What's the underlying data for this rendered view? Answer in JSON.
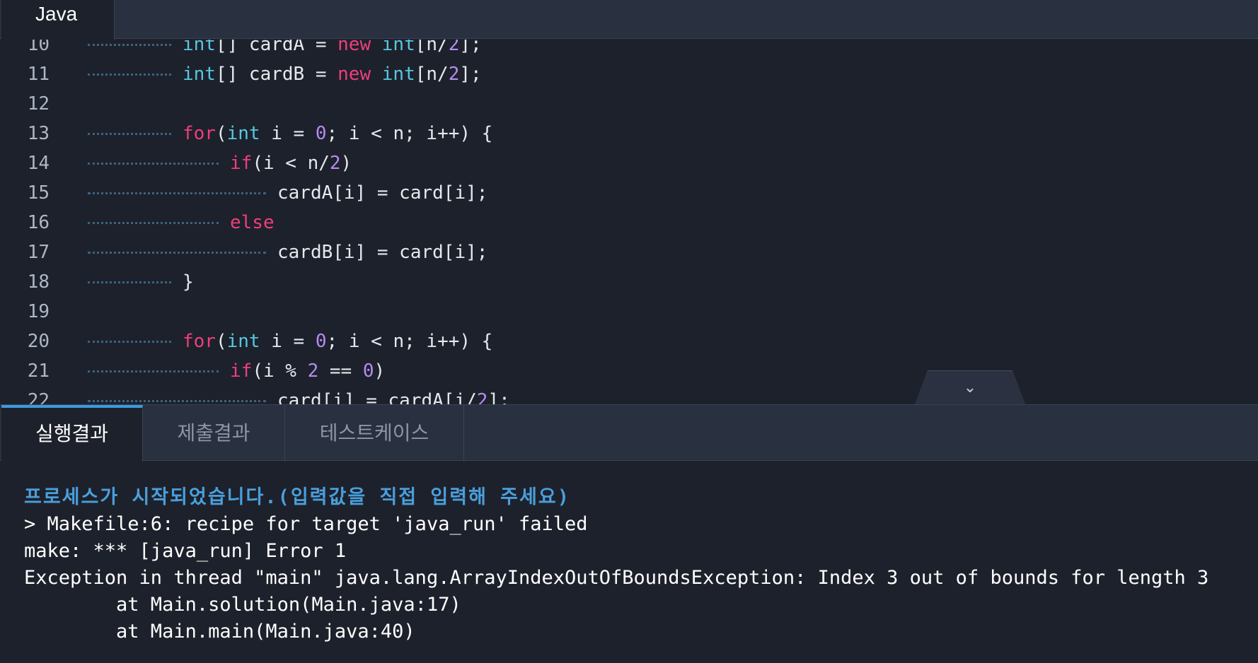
{
  "editor": {
    "language_tab": "Java",
    "lines": [
      {
        "num": "10",
        "indent": 2,
        "tokens": [
          [
            "ty",
            "int"
          ],
          [
            "p",
            "[] cardA = "
          ],
          [
            "kw",
            "new"
          ],
          [
            "p",
            " "
          ],
          [
            "ty",
            "int"
          ],
          [
            "p",
            "[n/"
          ],
          [
            "nm",
            "2"
          ],
          [
            "p",
            "];"
          ]
        ]
      },
      {
        "num": "11",
        "indent": 2,
        "tokens": [
          [
            "ty",
            "int"
          ],
          [
            "p",
            "[] cardB = "
          ],
          [
            "kw",
            "new"
          ],
          [
            "p",
            " "
          ],
          [
            "ty",
            "int"
          ],
          [
            "p",
            "[n/"
          ],
          [
            "nm",
            "2"
          ],
          [
            "p",
            "];"
          ]
        ]
      },
      {
        "num": "12",
        "indent": 0,
        "tokens": []
      },
      {
        "num": "13",
        "indent": 2,
        "tokens": [
          [
            "kw",
            "for"
          ],
          [
            "p",
            "("
          ],
          [
            "ty",
            "int"
          ],
          [
            "p",
            " i = "
          ],
          [
            "nm",
            "0"
          ],
          [
            "p",
            "; i < n; i++) {"
          ]
        ]
      },
      {
        "num": "14",
        "indent": 3,
        "tokens": [
          [
            "kw",
            "if"
          ],
          [
            "p",
            "(i < n/"
          ],
          [
            "nm",
            "2"
          ],
          [
            "p",
            ")"
          ]
        ]
      },
      {
        "num": "15",
        "indent": 4,
        "tokens": [
          [
            "p",
            "cardA[i] = card[i];"
          ]
        ]
      },
      {
        "num": "16",
        "indent": 3,
        "tokens": [
          [
            "kw",
            "else"
          ]
        ]
      },
      {
        "num": "17",
        "indent": 4,
        "tokens": [
          [
            "p",
            "cardB[i] = card[i];"
          ]
        ]
      },
      {
        "num": "18",
        "indent": 2,
        "tokens": [
          [
            "p",
            "}"
          ]
        ]
      },
      {
        "num": "19",
        "indent": 0,
        "tokens": []
      },
      {
        "num": "20",
        "indent": 2,
        "tokens": [
          [
            "kw",
            "for"
          ],
          [
            "p",
            "("
          ],
          [
            "ty",
            "int"
          ],
          [
            "p",
            " i = "
          ],
          [
            "nm",
            "0"
          ],
          [
            "p",
            "; i < n; i++) {"
          ]
        ]
      },
      {
        "num": "21",
        "indent": 3,
        "tokens": [
          [
            "kw",
            "if"
          ],
          [
            "p",
            "(i % "
          ],
          [
            "nm",
            "2"
          ],
          [
            "p",
            " == "
          ],
          [
            "nm",
            "0"
          ],
          [
            "p",
            ")"
          ]
        ]
      },
      {
        "num": "22",
        "indent": 4,
        "tokens": [
          [
            "p",
            "card[i] = cardA[i/"
          ],
          [
            "nm",
            "2"
          ],
          [
            "p",
            "];"
          ]
        ]
      }
    ],
    "collapse_icon": "chevron-down-icon"
  },
  "result_tabs": [
    "실행결과",
    "제출결과",
    "테스트케이스"
  ],
  "console": {
    "lines": [
      {
        "kind": "info",
        "text": "프로세스가 시작되었습니다.(입력값을 직접 입력해 주세요)"
      },
      {
        "kind": "plain",
        "text": "> Makefile:6: recipe for target 'java_run' failed"
      },
      {
        "kind": "plain",
        "text": "make: *** [java_run] Error 1"
      },
      {
        "kind": "plain",
        "text": "Exception in thread \"main\" java.lang.ArrayIndexOutOfBoundsException: Index 3 out of bounds for length 3"
      },
      {
        "kind": "plain",
        "text": "        at Main.solution(Main.java:17)"
      },
      {
        "kind": "plain",
        "text": "        at Main.main(Main.java:40)"
      }
    ]
  },
  "colors": {
    "background": "#1d212b",
    "keyword": "#ee3f7b",
    "type": "#56c7e0",
    "number": "#b48cf0",
    "info": "#4a9fdc",
    "active_tab_accent": "#3a9be0"
  }
}
